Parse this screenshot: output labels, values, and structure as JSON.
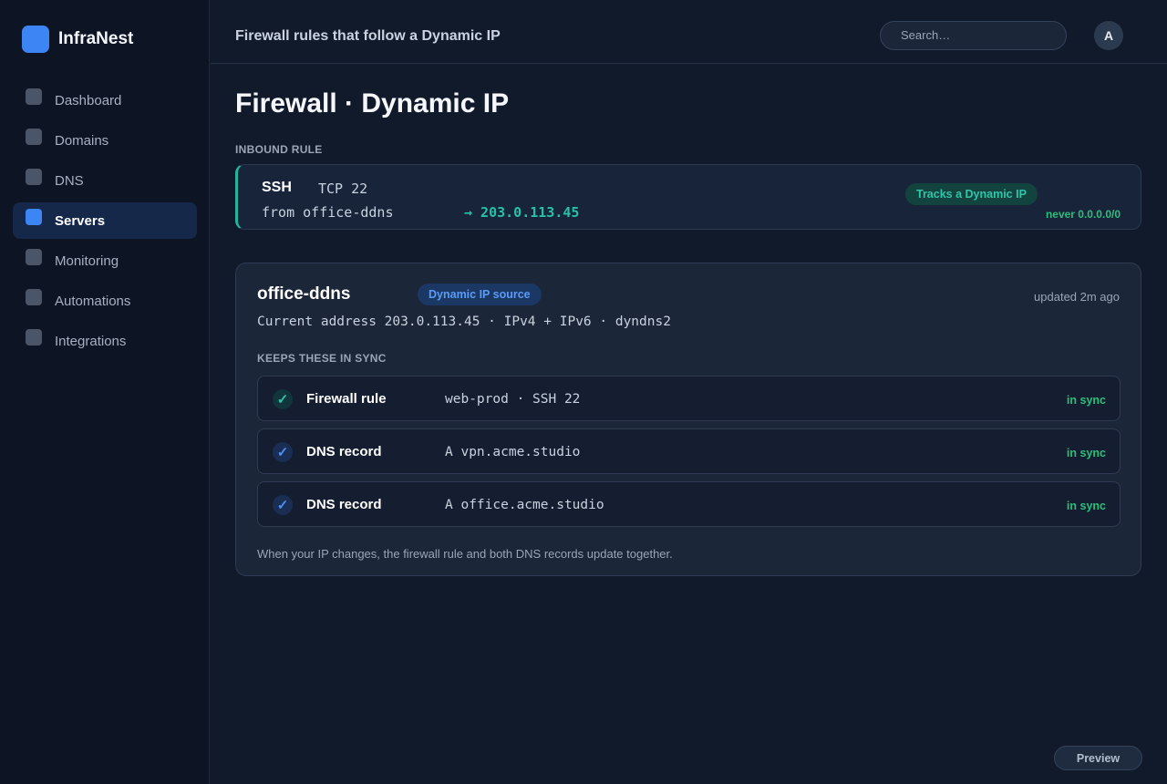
{
  "app": {
    "name": "InfraNest"
  },
  "sidebar": {
    "items": [
      {
        "label": "Dashboard",
        "active": false
      },
      {
        "label": "Domains",
        "active": false
      },
      {
        "label": "DNS",
        "active": false
      },
      {
        "label": "Servers",
        "active": true
      },
      {
        "label": "Monitoring",
        "active": false
      },
      {
        "label": "Automations",
        "active": false
      },
      {
        "label": "Integrations",
        "active": false
      }
    ]
  },
  "header": {
    "title": "Firewall rules that follow a Dynamic IP",
    "search_placeholder": "Search…",
    "avatar_initial": "A"
  },
  "main": {
    "title": "Firewall · Dynamic IP",
    "inbound_label": "INBOUND RULE",
    "rule": {
      "protocol": "SSH",
      "port": "TCP 22",
      "from": "from office-ddns",
      "target": "→ 203.0.113.45",
      "badge": "Tracks a Dynamic IP",
      "note": "never 0.0.0.0/0"
    },
    "source": {
      "name": "office-ddns",
      "badge": "Dynamic IP source",
      "updated": "updated 2m ago",
      "meta": "Current address 203.0.113.45 · IPv4 + IPv6 · dyndns2",
      "sync_label": "KEEPS THESE IN SYNC",
      "sync_items": [
        {
          "kind": "Firewall rule",
          "target": "web-prod · SSH 22",
          "status": "in sync",
          "icon": "check-icon"
        },
        {
          "kind": "DNS record",
          "target": "A vpn.acme.studio",
          "status": "in sync",
          "icon": "check-icon"
        },
        {
          "kind": "DNS record",
          "target": "A office.acme.studio",
          "status": "in sync",
          "icon": "check-icon"
        }
      ],
      "footer": "When your IP changes, the firewall rule and both DNS records update together."
    },
    "preview_label": "Preview"
  },
  "colors": {
    "accent": "#3d84f5",
    "teal": "#27c1a6",
    "status_ok": "#2cbf7a",
    "background": "#111a2b"
  }
}
